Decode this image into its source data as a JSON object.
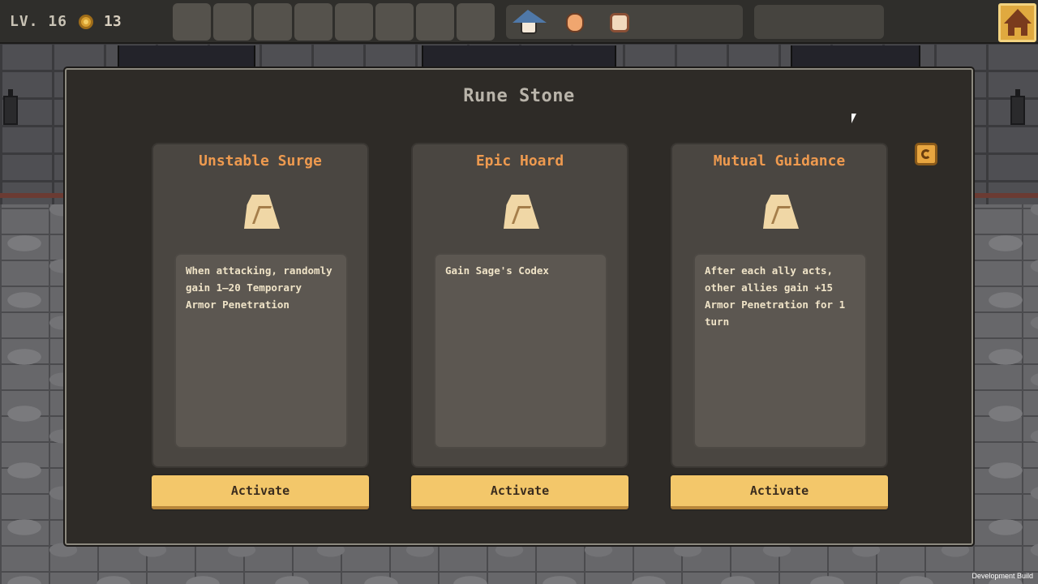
{
  "hud": {
    "level": "LV. 16",
    "coins": "13",
    "item_slots": 8,
    "party": [
      "mage-portrait",
      "monk-portrait",
      "rogue-portrait"
    ]
  },
  "panel": {
    "title": "Rune Stone"
  },
  "cards": [
    {
      "title": "Unstable Surge",
      "description": "When attacking, randomly gain 1—20 Temporary Armor Penetration",
      "button": "Activate",
      "icon": "rune-stone-icon"
    },
    {
      "title": "Epic Hoard",
      "description": "Gain Sage's Codex",
      "button": "Activate",
      "icon": "rune-stone-icon"
    },
    {
      "title": "Mutual Guidance",
      "description": "After each ally acts, other allies gain +15 Armor Penetration for 1 turn",
      "button": "Activate",
      "icon": "rune-stone-icon"
    }
  ],
  "footer": {
    "build_label": "Development Build"
  },
  "colors": {
    "card_title": "#ee9a4f",
    "button": "#f3c76a",
    "panel": "#2e2b27"
  }
}
